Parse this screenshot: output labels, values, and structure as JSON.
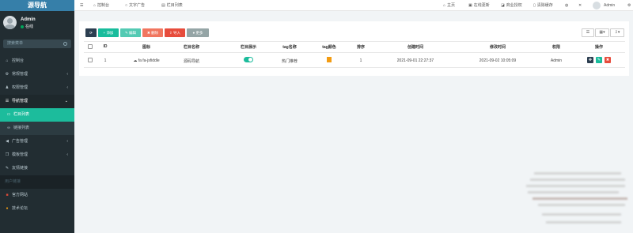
{
  "sidebar": {
    "logo": "源导航",
    "user_name": "Admin",
    "user_status": "在线",
    "search_placeholder": "搜索菜单",
    "items": [
      {
        "label": "控制台",
        "icon": "dashboard-icon"
      },
      {
        "label": "常规管理",
        "icon": "cogs-icon"
      },
      {
        "label": "权限管理",
        "icon": "group-icon"
      },
      {
        "label": "导航管理",
        "icon": "list-icon"
      },
      {
        "label": "栏目列表",
        "icon": "circle-icon"
      },
      {
        "label": "链接列表",
        "icon": "link-icon"
      },
      {
        "label": "广告管理",
        "icon": "bullhorn-icon"
      },
      {
        "label": "模板管理",
        "icon": "clone-icon"
      },
      {
        "label": "友情链接",
        "icon": "wrench-icon"
      }
    ],
    "section_header": "用户链接",
    "extra_items": [
      {
        "label": "官方网站",
        "icon": "globe-icon",
        "color": "#dd4b39"
      },
      {
        "label": "技术论坛",
        "icon": "comment-icon",
        "color": "#f39c12"
      }
    ]
  },
  "topnav": {
    "tabs": [
      "控制台",
      "文字广告",
      "栏目列表"
    ],
    "right": [
      "主页",
      "在线更新",
      "商业授权",
      "清除缓存"
    ],
    "user": "Admin"
  },
  "toolbar": {
    "add": "添加",
    "edit": "编辑",
    "delete": "删除",
    "import": "导入",
    "more": "更多"
  },
  "table": {
    "headers": [
      "ID",
      "图标",
      "栏目名称",
      "栏目展示",
      "tag名称",
      "tag颜色",
      "排序",
      "创建时间",
      "修改时间",
      "权限",
      "操作"
    ],
    "rows": [
      {
        "id": "1",
        "icon": "fa fa-jsfiddle",
        "name": "源码导航",
        "tag_name": "热门推荐",
        "sort": "1",
        "created": "2021-09-01 22:27:37",
        "modified": "2021-09-02 10:05:09",
        "permission": "Admin"
      }
    ]
  },
  "colors": {
    "sidebar_bg": "#222d32",
    "active": "#1cbc9c",
    "tag_color": "#f39c12",
    "btn_add": "#18bc9c",
    "btn_edit": "#53cab3",
    "btn_delete": "#f1765f",
    "btn_import": "#e74c3c",
    "btn_more": "#95a5a6",
    "btn_refresh": "#2c3e50"
  }
}
